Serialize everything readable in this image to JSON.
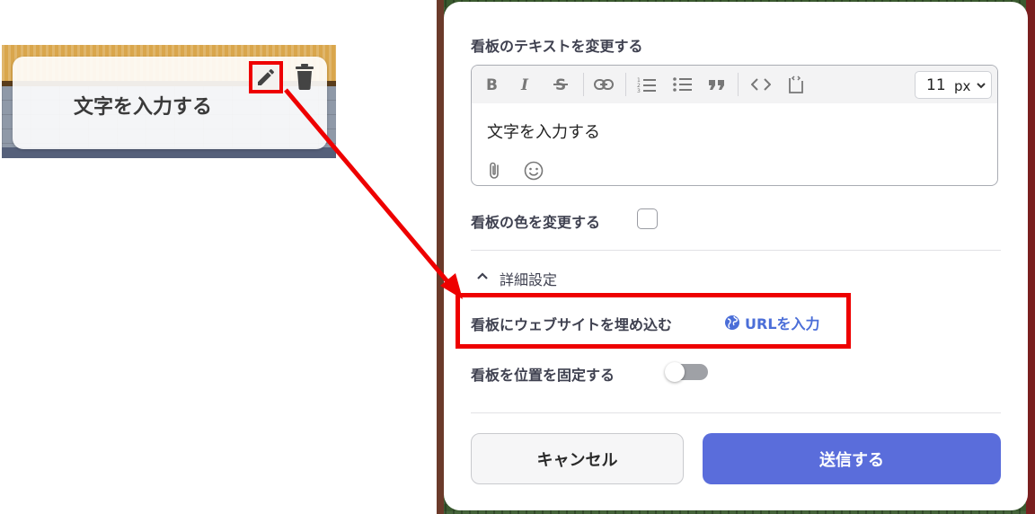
{
  "left_preview": {
    "sign_text": "文字を入力する",
    "icons": [
      "pencil-icon",
      "trash-icon"
    ]
  },
  "dialog": {
    "text_section_label": "看板のテキストを変更する",
    "toolbar": {
      "buttons": [
        "bold-icon",
        "italic-icon",
        "strikethrough-icon",
        "link-icon",
        "ordered-list-icon",
        "bullet-list-icon",
        "quote-icon",
        "code-icon",
        "code-block-icon"
      ],
      "font_size_value": "11",
      "font_size_unit": "px"
    },
    "editor_text": "文字を入力する",
    "color_label": "看板の色を変更する",
    "details_label": "詳細設定",
    "embed_label": "看板にウェブサイトを埋め込む",
    "url_link_label": "URLを入力",
    "pin_label": "看板を位置を固定する",
    "pin_toggle_on": false,
    "cancel_label": "キャンセル",
    "submit_label": "送信する"
  },
  "colors": {
    "accent": "#5a6ddb",
    "link": "#4b6ed8",
    "highlight": "#ee0000"
  }
}
